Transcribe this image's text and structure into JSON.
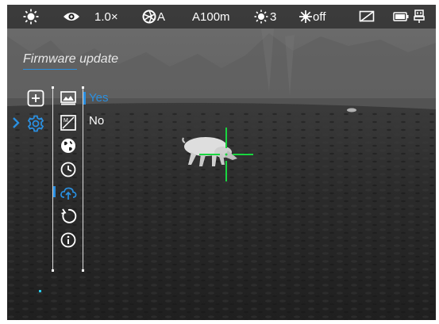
{
  "status_bar": {
    "brightness_icon": "sun-icon",
    "mode_icon": "eye-icon",
    "zoom": "1.0×",
    "calibration_mode": "A",
    "rangefinder": "A100m",
    "contrast_level": "3",
    "ir_illuminator": "off",
    "display_icon": "display-off-icon",
    "battery_icon": "battery-icon",
    "power_icon": "external-power-icon"
  },
  "menu": {
    "title": "Firmware update",
    "left_nav": [
      {
        "icon": "plus-box-icon"
      },
      {
        "icon": "gear-icon",
        "selected": true
      }
    ],
    "items": [
      {
        "icon": "picture-icon"
      },
      {
        "icon": "calibration-icon"
      },
      {
        "icon": "globe-icon"
      },
      {
        "icon": "clock-icon"
      },
      {
        "icon": "cloud-upload-icon",
        "selected": true
      },
      {
        "icon": "reset-icon"
      },
      {
        "icon": "info-icon"
      }
    ],
    "options": {
      "yes": "Yes",
      "no": "No",
      "selected": "Yes"
    }
  },
  "colors": {
    "accent": "#2a8fe0",
    "reticle": "#19d640",
    "text": "#ffffff"
  }
}
